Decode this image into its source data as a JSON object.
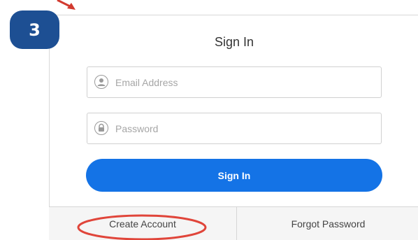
{
  "step_badge": {
    "number": "3",
    "color": "#1d4f93"
  },
  "form": {
    "title": "Sign In",
    "email": {
      "placeholder": "Email Address",
      "value": "",
      "icon": "user-icon"
    },
    "password": {
      "placeholder": "Password",
      "value": "",
      "icon": "lock-icon"
    },
    "submit_label": "Sign In",
    "accent_color": "#1473e6"
  },
  "footer": {
    "create_account_label": "Create Account",
    "forgot_password_label": "Forgot Password"
  },
  "annotations": {
    "highlight_color": "#e0453a",
    "highlight_target": "Create Account"
  }
}
